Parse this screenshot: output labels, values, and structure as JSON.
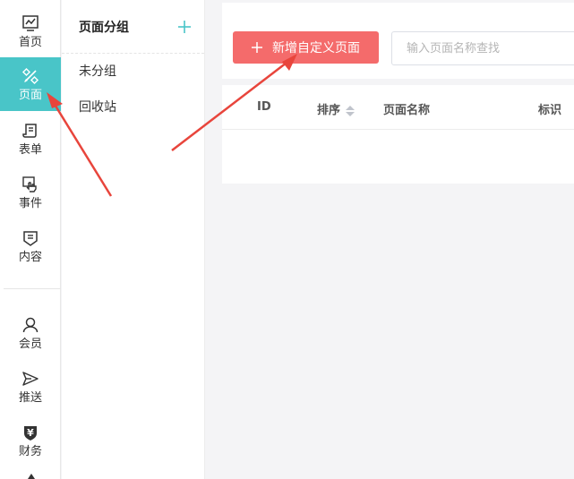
{
  "sidebar": {
    "items": [
      {
        "label": "首页",
        "icon": "dashboard-chart-icon"
      },
      {
        "label": "页面",
        "icon": "pencil-ruler-icon",
        "active": true
      },
      {
        "label": "表单",
        "icon": "form-scroll-icon"
      },
      {
        "label": "事件",
        "icon": "touch-hand-icon"
      },
      {
        "label": "内容",
        "icon": "document-shield-icon"
      },
      {
        "label": "会员",
        "icon": "user-icon"
      },
      {
        "label": "推送",
        "icon": "send-plane-icon"
      },
      {
        "label": "财务",
        "icon": "yuan-shield-icon"
      }
    ]
  },
  "groups": {
    "title": "页面分组",
    "items": [
      "未分组",
      "回收站"
    ]
  },
  "toolbar": {
    "add_label": "新增自定义页面",
    "search_placeholder": "输入页面名称查找"
  },
  "table": {
    "columns": [
      "ID",
      "排序",
      "页面名称",
      "标识"
    ]
  },
  "colors": {
    "accent": "#49c5c8",
    "primary_button": "#f46b6b",
    "arrow": "#e8453c"
  }
}
